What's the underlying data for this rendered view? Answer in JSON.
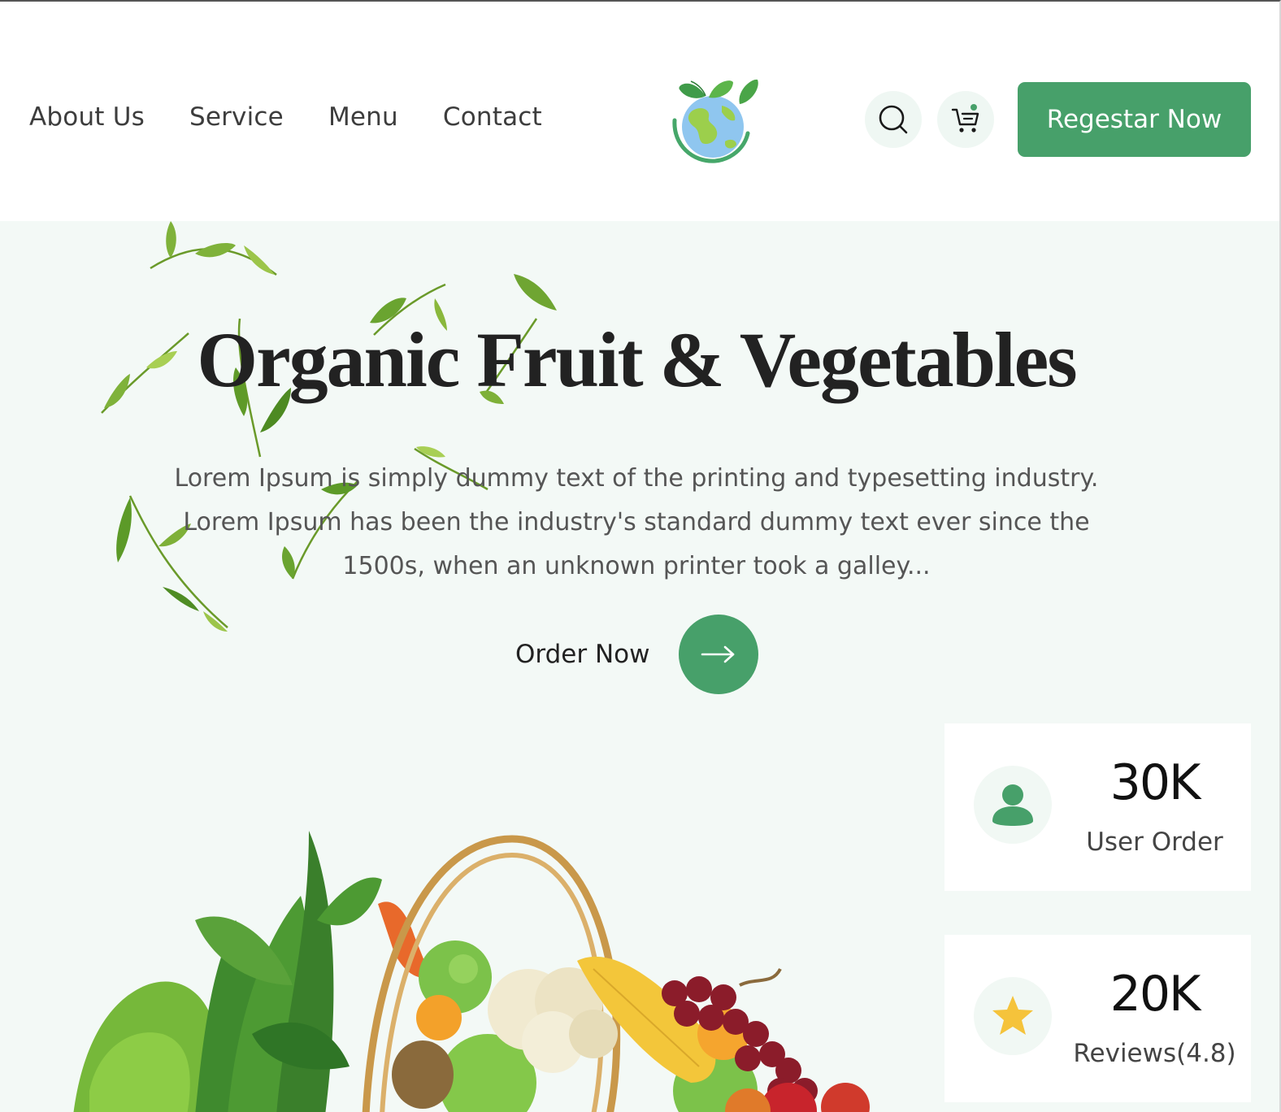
{
  "nav": {
    "items": [
      {
        "label": "About Us"
      },
      {
        "label": "Service"
      },
      {
        "label": "Menu"
      },
      {
        "label": "Contact"
      }
    ]
  },
  "header": {
    "register_label": "Regestar Now",
    "icons": [
      "search-icon",
      "cart-icon"
    ]
  },
  "hero": {
    "title": "Organic Fruit & Vegetables",
    "description": "Lorem Ipsum is simply dummy text of the printing and typesetting industry. Lorem Ipsum has been the industry's standard dummy text ever since the 1500s, when an unknown printer took a galley...",
    "order_label": "Order Now"
  },
  "stats": [
    {
      "value": "30K",
      "label": "User Order",
      "icon": "user-icon"
    },
    {
      "value": "20K",
      "label": "Reviews(4.8)",
      "icon": "star-icon"
    }
  ],
  "colors": {
    "accent": "#47a06a",
    "hero_bg": "#f3f9f6",
    "star": "#f5c33b"
  }
}
